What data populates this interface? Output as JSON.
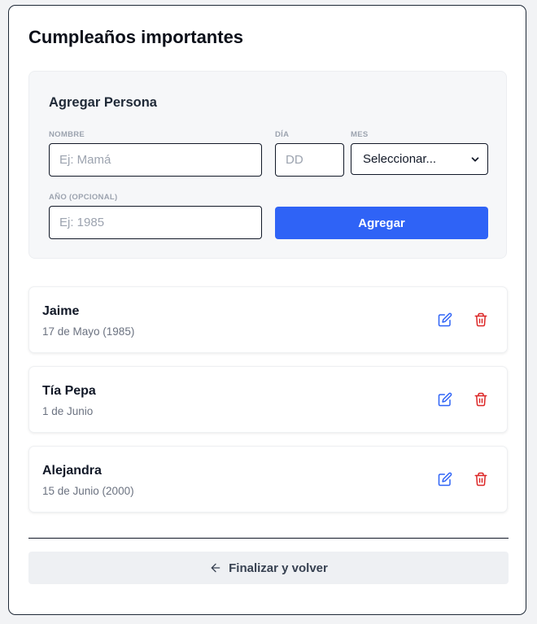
{
  "page": {
    "title": "Cumpleaños importantes"
  },
  "form": {
    "title": "Agregar Persona",
    "name_label": "NOMBRE",
    "name_placeholder": "Ej: Mamá",
    "day_label": "DÍA",
    "day_placeholder": "DD",
    "month_label": "MES",
    "month_selected": "Seleccionar...",
    "year_label": "AÑO (OPCIONAL)",
    "year_placeholder": "Ej: 1985",
    "submit_label": "Agregar"
  },
  "people": [
    {
      "name": "Jaime",
      "date": "17 de Mayo (1985)"
    },
    {
      "name": "Tía Pepa",
      "date": "1 de Junio"
    },
    {
      "name": "Alejandra",
      "date": "15 de Junio (2000)"
    }
  ],
  "footer": {
    "finish_label": "Finalizar y volver"
  },
  "icons": {
    "edit": "edit-icon",
    "delete": "trash-icon",
    "back": "arrow-left-icon",
    "dropdown": "chevron-down-icon"
  },
  "colors": {
    "primary": "#2f63f6",
    "edit_icon": "#2f63f6",
    "delete_icon": "#dc2626"
  }
}
